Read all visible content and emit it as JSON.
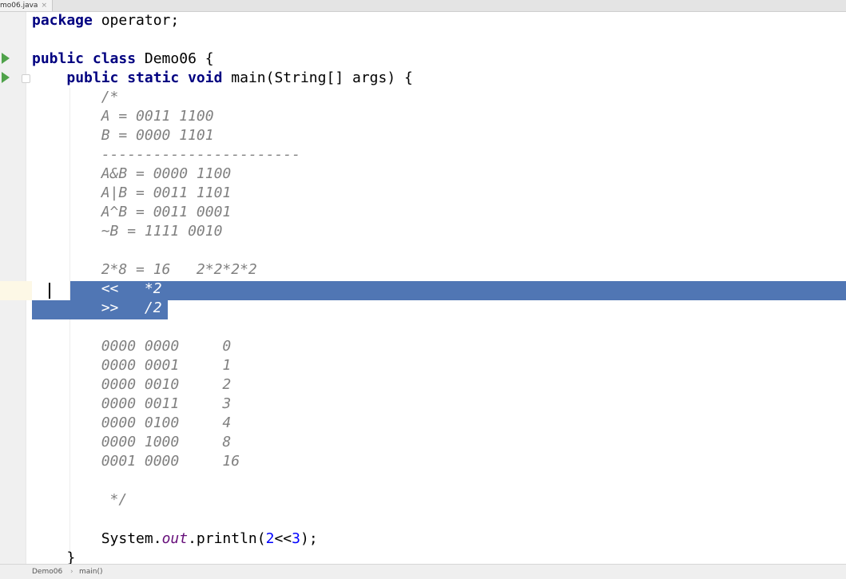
{
  "tab": {
    "title": "mo06.java",
    "close": "×"
  },
  "code": {
    "l1": "package operator;",
    "l3": "public class Demo06 {",
    "l4": "    public static void main(String[] args) {",
    "c1": "        /*",
    "c2": "        A = 0011 1100",
    "c3": "        B = 0000 1101",
    "c4": "        -----------------------",
    "c5": "        A&B = 0000 1100",
    "c6": "        A|B = 0011 1101",
    "c7": "        A^B = 0011 0001",
    "c8": "        ~B = 1111 0010",
    "c10": "        2*8 = 16   2*2*2*2",
    "c11": "        <<   *2",
    "c12": "        >>   /2",
    "c14": "        0000 0000     0",
    "c15": "        0000 0001     1",
    "c16": "        0000 0010     2",
    "c17": "        0000 0011     3",
    "c18": "        0000 0100     4",
    "c19": "        0000 1000     8",
    "c20": "        0001 0000     16",
    "c22": "         */",
    "println_pre": "        System.",
    "println_out": "out",
    "println_mid": ".println(",
    "println_num1": "2",
    "println_op": "<<",
    "println_num2": "3",
    "println_end": ");",
    "close_brace": "    }"
  },
  "breadcrumb": {
    "class": "Demo06",
    "method": "main()"
  },
  "colors": {
    "selection": "#5076b4",
    "keyword": "#000080",
    "comment": "#808080",
    "run": "#4fa24a"
  }
}
